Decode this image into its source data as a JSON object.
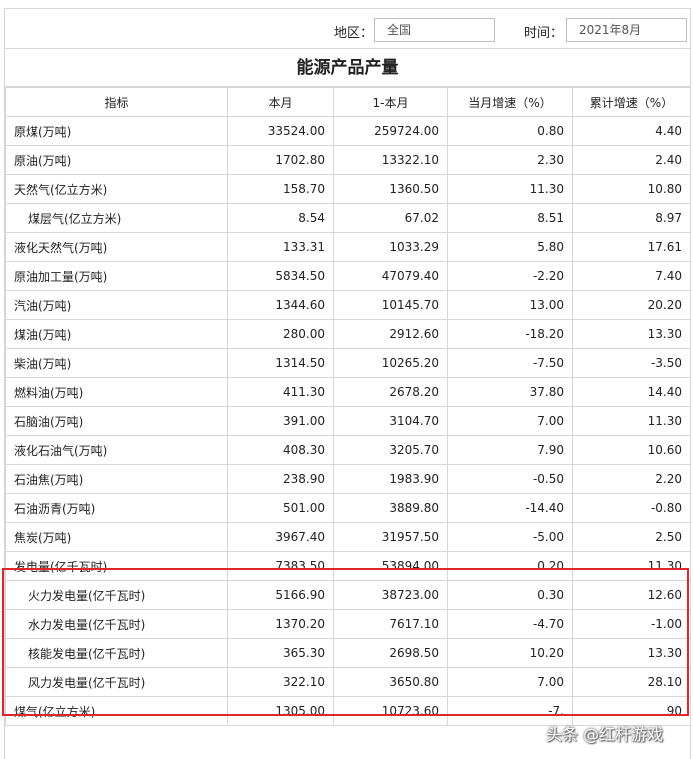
{
  "filters": {
    "region_label": "地区：",
    "region_value": "全国",
    "time_label": "时间：",
    "time_value": "2021年8月"
  },
  "table_title": "能源产品产量",
  "columns": [
    "指标",
    "本月",
    "1-本月",
    "当月增速（%）",
    "累计增速（%）"
  ],
  "rows": [
    {
      "name": "原煤(万吨)",
      "indent": false,
      "month": "33524.00",
      "ytd": "259724.00",
      "mom": "0.80",
      "cum": "4.40"
    },
    {
      "name": "原油(万吨)",
      "indent": false,
      "month": "1702.80",
      "ytd": "13322.10",
      "mom": "2.30",
      "cum": "2.40"
    },
    {
      "name": "天然气(亿立方米)",
      "indent": false,
      "month": "158.70",
      "ytd": "1360.50",
      "mom": "11.30",
      "cum": "10.80"
    },
    {
      "name": "煤层气(亿立方米)",
      "indent": true,
      "month": "8.54",
      "ytd": "67.02",
      "mom": "8.51",
      "cum": "8.97"
    },
    {
      "name": "液化天然气(万吨)",
      "indent": false,
      "month": "133.31",
      "ytd": "1033.29",
      "mom": "5.80",
      "cum": "17.61"
    },
    {
      "name": "原油加工量(万吨)",
      "indent": false,
      "month": "5834.50",
      "ytd": "47079.40",
      "mom": "-2.20",
      "cum": "7.40"
    },
    {
      "name": "汽油(万吨)",
      "indent": false,
      "month": "1344.60",
      "ytd": "10145.70",
      "mom": "13.00",
      "cum": "20.20"
    },
    {
      "name": "煤油(万吨)",
      "indent": false,
      "month": "280.00",
      "ytd": "2912.60",
      "mom": "-18.20",
      "cum": "13.30"
    },
    {
      "name": "柴油(万吨)",
      "indent": false,
      "month": "1314.50",
      "ytd": "10265.20",
      "mom": "-7.50",
      "cum": "-3.50"
    },
    {
      "name": "燃料油(万吨)",
      "indent": false,
      "month": "411.30",
      "ytd": "2678.20",
      "mom": "37.80",
      "cum": "14.40"
    },
    {
      "name": "石脑油(万吨)",
      "indent": false,
      "month": "391.00",
      "ytd": "3104.70",
      "mom": "7.00",
      "cum": "11.30"
    },
    {
      "name": "液化石油气(万吨)",
      "indent": false,
      "month": "408.30",
      "ytd": "3205.70",
      "mom": "7.90",
      "cum": "10.60"
    },
    {
      "name": "石油焦(万吨)",
      "indent": false,
      "month": "238.90",
      "ytd": "1983.90",
      "mom": "-0.50",
      "cum": "2.20"
    },
    {
      "name": "石油沥青(万吨)",
      "indent": false,
      "month": "501.00",
      "ytd": "3889.80",
      "mom": "-14.40",
      "cum": "-0.80"
    },
    {
      "name": "焦炭(万吨)",
      "indent": false,
      "month": "3967.40",
      "ytd": "31957.50",
      "mom": "-5.00",
      "cum": "2.50"
    },
    {
      "name": "发电量(亿千瓦时)",
      "indent": false,
      "month": "7383.50",
      "ytd": "53894.00",
      "mom": "0.20",
      "cum": "11.30"
    },
    {
      "name": "火力发电量(亿千瓦时)",
      "indent": true,
      "month": "5166.90",
      "ytd": "38723.00",
      "mom": "0.30",
      "cum": "12.60"
    },
    {
      "name": "水力发电量(亿千瓦时)",
      "indent": true,
      "month": "1370.20",
      "ytd": "7617.10",
      "mom": "-4.70",
      "cum": "-1.00"
    },
    {
      "name": "核能发电量(亿千瓦时)",
      "indent": true,
      "month": "365.30",
      "ytd": "2698.50",
      "mom": "10.20",
      "cum": "13.30"
    },
    {
      "name": "风力发电量(亿千瓦时)",
      "indent": true,
      "month": "322.10",
      "ytd": "3650.80",
      "mom": "7.00",
      "cum": "28.10"
    },
    {
      "name": "煤气(亿立方米)",
      "indent": false,
      "month": "1305.00",
      "ytd": "10723.60",
      "mom": "-7.",
      "cum": "90"
    }
  ],
  "watermark": "头条 @红杆游戏",
  "colors": {
    "border": "#d6d6d6",
    "highlight_box": "#e0262d",
    "text": "#222222"
  }
}
